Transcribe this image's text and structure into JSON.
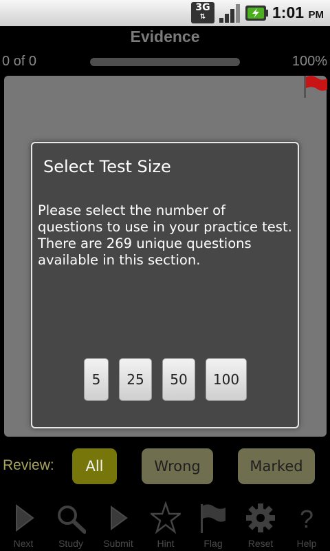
{
  "status_bar": {
    "network": "3G",
    "time": "1:01",
    "ampm": "PM"
  },
  "header": {
    "title": "Evidence",
    "progress_count": "0 of 0",
    "progress_percent": "100%",
    "progress_value": 1.0
  },
  "dialog": {
    "title": "Select Test Size",
    "message": "Please select the number of questions to use in your practice test. There are 269 unique questions available in this section.",
    "options": [
      "5",
      "25",
      "50",
      "100"
    ]
  },
  "review": {
    "label": "Review:",
    "buttons": [
      "All",
      "Wrong",
      "Marked"
    ],
    "selected": "All"
  },
  "toolbar": {
    "items": [
      {
        "label": "Next",
        "icon": "next-arrow-icon"
      },
      {
        "label": "Study",
        "icon": "magnifier-icon"
      },
      {
        "label": "Submit",
        "icon": "submit-arrow-icon"
      },
      {
        "label": "Hint",
        "icon": "star-icon"
      },
      {
        "label": "Flag",
        "icon": "flag-icon"
      },
      {
        "label": "Reset",
        "icon": "gear-icon"
      },
      {
        "label": "Help",
        "icon": "question-icon"
      }
    ]
  },
  "colors": {
    "review_label": "#a5a35c",
    "review_selected": "#77760a",
    "review_unselected": "#6f6e4f",
    "flag": "#cc1111"
  }
}
